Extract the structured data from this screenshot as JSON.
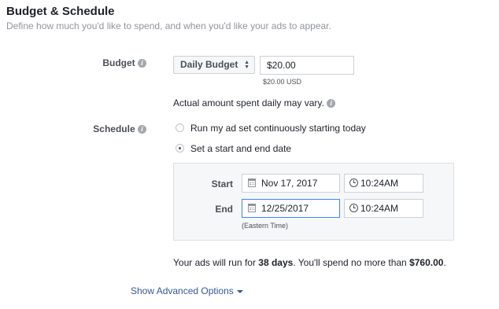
{
  "section": {
    "title": "Budget & Schedule",
    "subtitle": "Define how much you'd like to spend, and when you'd like your ads to appear."
  },
  "budget": {
    "label": "Budget",
    "type_selected": "Daily Budget",
    "amount_value": "$20.00",
    "amount_note": "$20.00 USD",
    "variance_note": "Actual amount spent daily may vary."
  },
  "schedule": {
    "label": "Schedule",
    "options": [
      {
        "label": "Run my ad set continuously starting today",
        "checked": false
      },
      {
        "label": "Set a start and end date",
        "checked": true
      }
    ],
    "start": {
      "label": "Start",
      "date": "Nov 17, 2017",
      "time": "10:24AM"
    },
    "end": {
      "label": "End",
      "date": "12/25/2017",
      "time": "10:24AM"
    },
    "timezone": "(Eastern Time)"
  },
  "summary": {
    "prefix": "Your ads will run for ",
    "days": "38 days",
    "middle": ". You'll spend no more than ",
    "amount": "$760.00",
    "suffix": "."
  },
  "advanced_link": "Show Advanced Options",
  "colors": {
    "link": "#365899",
    "focus": "#4080ff",
    "panel_bg": "#f6f7f9"
  }
}
